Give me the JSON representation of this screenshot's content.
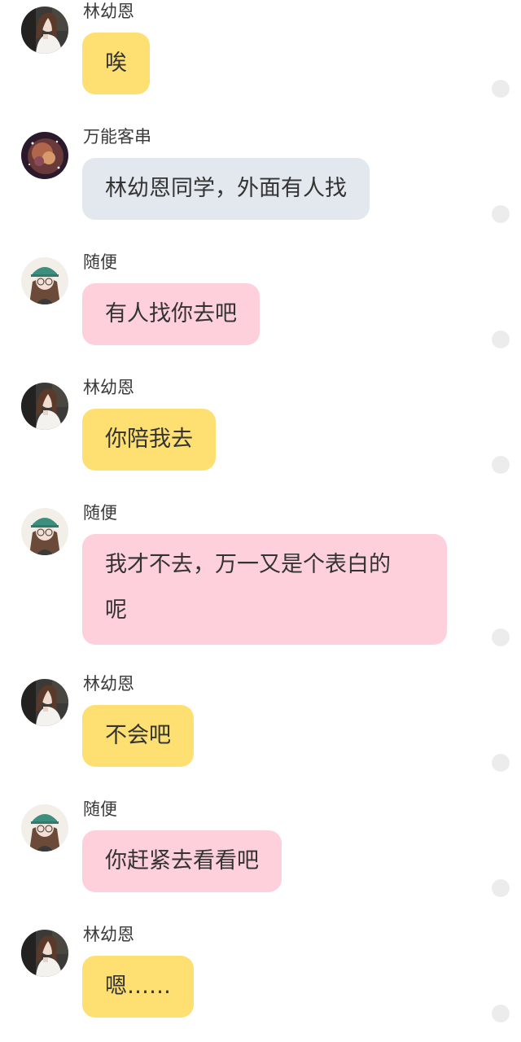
{
  "messages": [
    {
      "sender": "林幼恩",
      "text": "唉",
      "avatar": "girl-dark-hair-avatar",
      "bubble_color": "#fddf72"
    },
    {
      "sender": "万能客串",
      "text": "林幼恩同学，外面有人找",
      "avatar": "galaxy-avatar",
      "bubble_color": "#e2e8ee"
    },
    {
      "sender": "随便",
      "text": "有人找你去吧",
      "avatar": "girl-cap-glasses-avatar",
      "bubble_color": "#fdd0dc"
    },
    {
      "sender": "林幼恩",
      "text": "你陪我去",
      "avatar": "girl-dark-hair-avatar",
      "bubble_color": "#fddf72"
    },
    {
      "sender": "随便",
      "text_line1": "我才不去，万一又是个表白的",
      "text_line2": "呢",
      "avatar": "girl-cap-glasses-avatar",
      "bubble_color": "#fdd0dc"
    },
    {
      "sender": "林幼恩",
      "text": "不会吧",
      "avatar": "girl-dark-hair-avatar",
      "bubble_color": "#fddf72"
    },
    {
      "sender": "随便",
      "text": "你赶紧去看看吧",
      "avatar": "girl-cap-glasses-avatar",
      "bubble_color": "#fdd0dc"
    },
    {
      "sender": "林幼恩",
      "text": "嗯……",
      "avatar": "girl-dark-hair-avatar",
      "bubble_color": "#fddf72"
    }
  ],
  "status_dot_icon": "unread-dot-icon"
}
